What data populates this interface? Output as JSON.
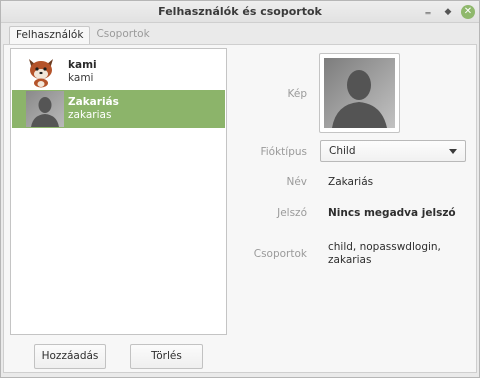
{
  "window": {
    "title": "Felhasználók és csoportok"
  },
  "tabs": [
    {
      "label": "Felhasználók",
      "active": true
    },
    {
      "label": "Csoportok",
      "active": false
    }
  ],
  "users": [
    {
      "name": "kami",
      "login": "kami",
      "avatar": "fox-icon",
      "selected": false
    },
    {
      "name": "Zakariás",
      "login": "zakarias",
      "avatar": "person-silhouette-icon",
      "selected": true
    }
  ],
  "buttons": {
    "add_label": "Hozzáadás",
    "delete_label": "Törlés"
  },
  "details": {
    "picture_label": "Kép",
    "account_type_label": "Fióktípus",
    "account_type_value": "Child",
    "name_label": "Név",
    "name_value": "Zakariás",
    "password_label": "Jelszó",
    "password_value": "Nincs megadva jelszó",
    "groups_label": "Csoportok",
    "groups_line1": "child, nopasswdlogin,",
    "groups_line2": "zakarias"
  },
  "colors": {
    "selection": "#8cb46a",
    "close_button": "#8fb86c",
    "window_bg": "#eaeaea"
  }
}
